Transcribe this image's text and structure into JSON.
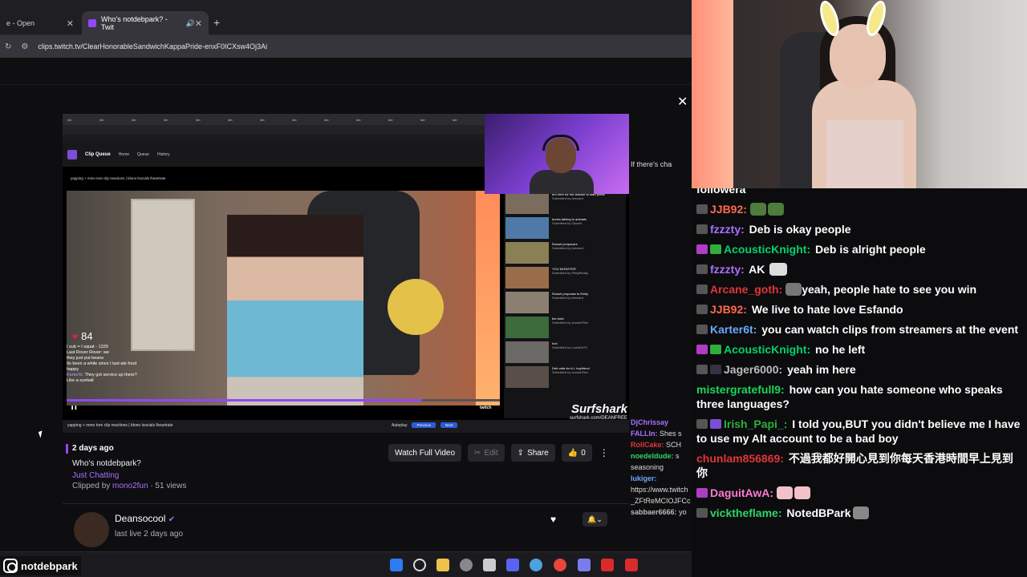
{
  "browser": {
    "tab1_title": "e - Open",
    "tab2_title": "Who's notdebpark? - Twit",
    "url": "clips.twitch.tv/ClearHonorableSandwichKappaPride-enxF0ICXsw4Oj3Ai"
  },
  "clip": {
    "date": "2 days ago",
    "title": "Who's notdebpark?",
    "category": "Just Chatting",
    "clipped_by_prefix": "Clipped by",
    "clipper": "mono2fun",
    "views": "· 51 views",
    "watch_full": "Watch Full Video",
    "edit": "Edit",
    "share": "Share",
    "likes": "0"
  },
  "channel": {
    "name": "Deansocool",
    "last_live": "last live 2 days ago"
  },
  "player": {
    "viewer_count": "84",
    "inner_title": "Clip Queue",
    "inner_nav": [
      "Home",
      "Queue",
      "History"
    ],
    "clip_caption": "yapping + mmo tore clip reactions | ldono lsocials lheartrate",
    "controls_text": "They got service up there?",
    "autoplay": "Autoplay",
    "prev": "Previous",
    "next": "Next",
    "twitch": "twitch",
    "surfshark_brand": "Surfshark",
    "surfshark_url": "surfshark.com/DEANFREE",
    "queue": [
      {
        "title": "bro here for the answer to start prank",
        "by": "Submitted by beezard"
      },
      {
        "title": "bones talking to animals",
        "by": "Submitted by Clkeeit"
      },
      {
        "title": "Russel jumpscare",
        "by": "Submitted by beezard"
      },
      {
        "title": "YOU MONSTER",
        "by": "Submitted by PettyReddy"
      },
      {
        "title": "Russel proposes to Emily",
        "by": "Submitted by beezard"
      },
      {
        "title": "the truth",
        "by": "Submitted by smoothFlex"
      },
      {
        "title": "huh",
        "by": "Submitted by LouisDaTV"
      },
      {
        "title": "Deb calls for A.I. boyfriend",
        "by": "Submitted by smoothFlex"
      }
    ],
    "overlay_chat": [
      {
        "name": "",
        "text": "I sub = I squat - 1329"
      },
      {
        "name": "",
        "text": "Last Rover Rover: we"
      },
      {
        "name": "",
        "text": "they just put beans"
      },
      {
        "name": "",
        "text": "Its been a while since I last ate food"
      },
      {
        "name": "",
        "text": "happy"
      },
      {
        "name": "Karter6t:",
        "text": "They got service up there?"
      },
      {
        "name": "",
        "text": "Like a eyeball"
      }
    ]
  },
  "side_chat_peek": [
    {
      "name": "DjChrissay",
      "text": ""
    },
    {
      "name": "FALLIn:",
      "text": "Shes s"
    },
    {
      "name": "RollCake:",
      "text": "SCH"
    },
    {
      "name": "noedeldude:",
      "text": "s seasoning"
    },
    {
      "name": "lukiger:",
      "text": "https://www.twitch _ZFtReMCIOJFCc"
    },
    {
      "name": "sabbaer6666:",
      "text": "yo"
    }
  ],
  "chat_peek_top": "If there's cha",
  "chat": [
    {
      "name": "followera",
      "text": "",
      "color": "#ffffff"
    },
    {
      "name": "JJB92:",
      "text": "",
      "color": "#ff6a4d",
      "emote": true
    },
    {
      "name": "fzzzty:",
      "text": "Deb is okay people",
      "color": "#a970ff"
    },
    {
      "name": "AcousticKnight:",
      "text": "Deb is alright people",
      "color": "#00d26a"
    },
    {
      "name": "fzzzty:",
      "text": "AK",
      "color": "#a970ff"
    },
    {
      "name": "Arcane_goth:",
      "text": "yeah, people hate to see you win",
      "color": "#e0353a"
    },
    {
      "name": "JJB92:",
      "text": "We live to hate love Esfando",
      "color": "#ff6a4d"
    },
    {
      "name": "Karter6t:",
      "text": "you can watch clips from streamers at the event",
      "color": "#6aa8ff"
    },
    {
      "name": "AcousticKnight:",
      "text": "no he left",
      "color": "#00d26a"
    },
    {
      "name": "Jager6000:",
      "text": "yeah im here",
      "color": "#bcbcbc"
    },
    {
      "name": "mistergratefull9:",
      "text": "how can you hate someone who speaks three languages?",
      "color": "#19d65b"
    },
    {
      "name": "Irish_Papi_:",
      "text": "I told you,BUT you didn't believe me I have to use my Alt account to be a bad boy",
      "color": "#2fae3a"
    },
    {
      "name": "chunlam856869:",
      "text": "不過我都好開心見到你每天香港時間早上見到你",
      "color": "#e0353a"
    },
    {
      "name": "DaguitAwA:",
      "text": "",
      "color": "#ff7ad1",
      "emote": true
    },
    {
      "name": "vicktheflame:",
      "text": "NotedBPark",
      "color": "#2fd36b",
      "emote": true
    }
  ],
  "branding": {
    "handle": "notdebpark"
  },
  "colors": {
    "accent": "#9147ff",
    "link": "#a970ff",
    "background": "#0e0e10"
  }
}
